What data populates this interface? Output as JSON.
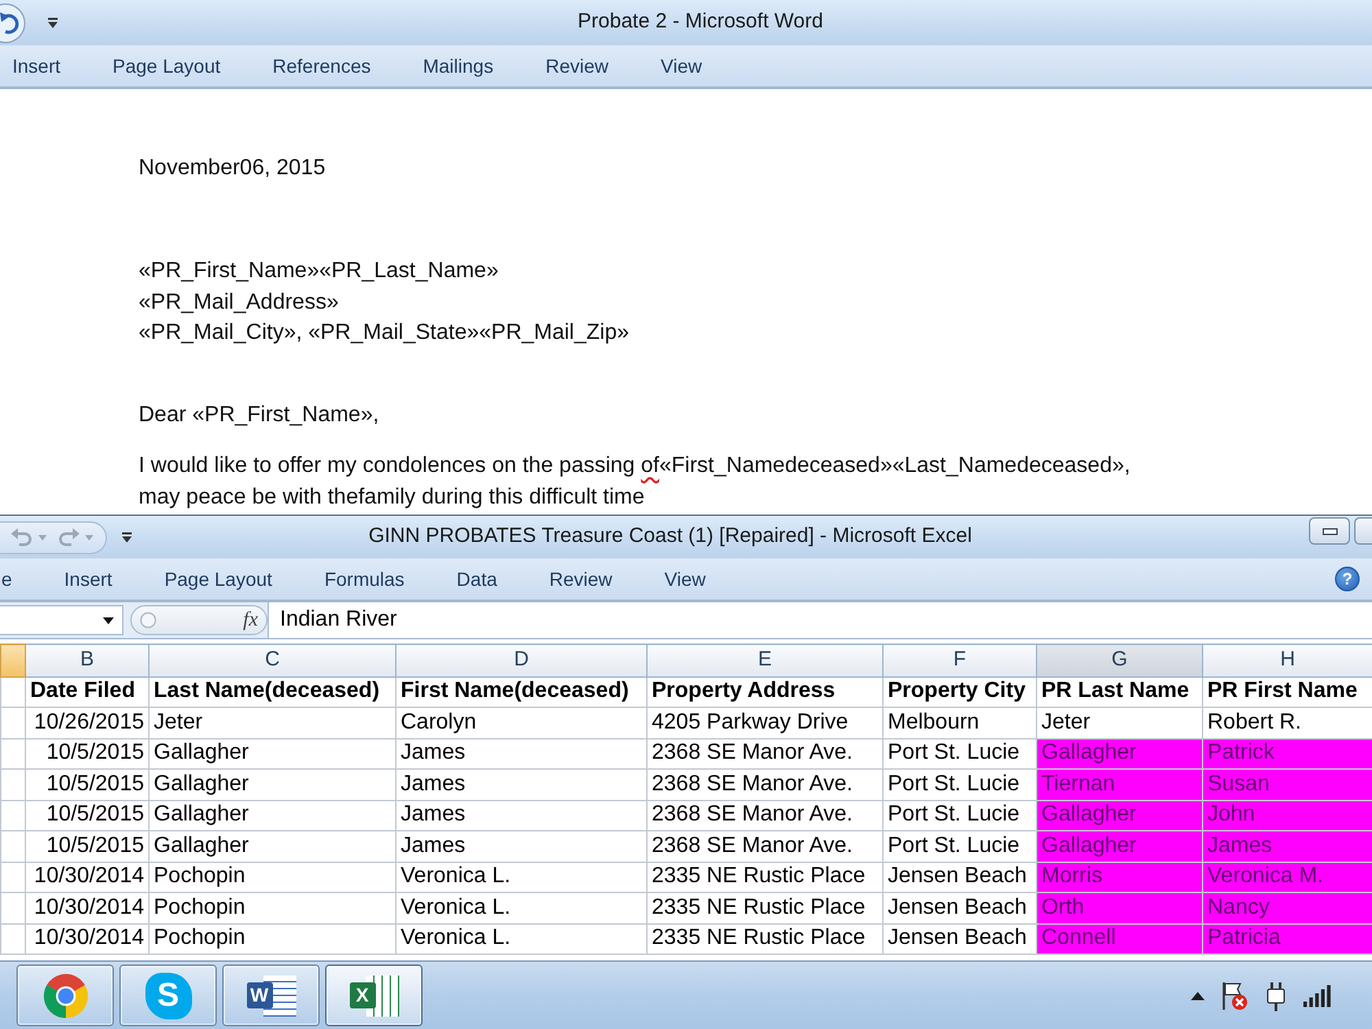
{
  "word": {
    "title": "Probate 2 - Microsoft Word",
    "tabs": [
      {
        "label": "Insert",
        "selected": false
      },
      {
        "label": "Page Layout",
        "selected": false
      },
      {
        "label": "References",
        "selected": false
      },
      {
        "label": "Mailings",
        "selected": false
      },
      {
        "label": "Review",
        "selected": false
      },
      {
        "label": "View",
        "selected": false
      }
    ],
    "document": {
      "date": "November06, 2015",
      "address_lines": [
        "«PR_First_Name»«PR_Last_Name»",
        "«PR_Mail_Address»",
        "«PR_Mail_City», «PR_Mail_State»«PR_Mail_Zip»"
      ],
      "salutation": "Dear «PR_First_Name»,",
      "paragraph_lines": [
        {
          "runs": [
            {
              "text": "I would like to offer my condolences on the passing ",
              "misspelled": false
            },
            {
              "text": "of",
              "misspelled": true
            },
            {
              "text": "«First_Namedeceased»«Last_Namedeceased»,",
              "misspelled": false
            }
          ]
        },
        {
          "runs": [
            {
              "text": "may peace be with thefamily during this difficult time",
              "misspelled": false
            }
          ]
        }
      ]
    }
  },
  "excel": {
    "title": "GINN PROBATES Treasure Coast (1) [Repaired] - Microsoft Excel",
    "tabs": [
      {
        "label": "e",
        "selected": false
      },
      {
        "label": "Insert",
        "selected": false
      },
      {
        "label": "Page Layout",
        "selected": false
      },
      {
        "label": "Formulas",
        "selected": false
      },
      {
        "label": "Data",
        "selected": false
      },
      {
        "label": "Review",
        "selected": false
      },
      {
        "label": "View",
        "selected": false
      }
    ],
    "help": "?",
    "formula_bar": {
      "function_button": "fx",
      "value": "Indian River"
    },
    "columns": [
      {
        "selected": true,
        "hovered": false
      },
      {
        "letter": "B",
        "selected": false,
        "hovered": false
      },
      {
        "letter": "C",
        "selected": false,
        "hovered": false
      },
      {
        "letter": "D",
        "selected": false,
        "hovered": false
      },
      {
        "letter": "E",
        "selected": false,
        "hovered": false
      },
      {
        "letter": "F",
        "selected": false,
        "hovered": false
      },
      {
        "letter": "G",
        "selected": false,
        "hovered": true
      },
      {
        "letter": "H",
        "selected": false,
        "hovered": false
      }
    ],
    "rows": [
      {
        "kind": "header",
        "cells": [
          "",
          "Date Filed",
          "Last Name(deceased)",
          "First Name(deceased)",
          "Property Address",
          "Property City",
          "PR Last Name",
          "PR First Name"
        ],
        "highlighted": false
      },
      {
        "kind": "data",
        "cells": [
          "",
          "10/26/2015",
          "Jeter",
          "Carolyn",
          "4205 Parkway Drive",
          "Melbourn",
          "Jeter",
          "Robert R."
        ],
        "highlighted": false
      },
      {
        "kind": "data",
        "cells": [
          "",
          "10/5/2015",
          "Gallagher",
          "James",
          "2368 SE Manor Ave.",
          "Port St. Lucie",
          "Gallagher",
          "Patrick"
        ],
        "highlighted": true
      },
      {
        "kind": "data",
        "cells": [
          "",
          "10/5/2015",
          "Gallagher",
          "James",
          "2368 SE Manor Ave.",
          "Port St. Lucie",
          "Tiernan",
          "Susan"
        ],
        "highlighted": true
      },
      {
        "kind": "data",
        "cells": [
          "",
          "10/5/2015",
          "Gallagher",
          "James",
          "2368 SE Manor Ave.",
          "Port St. Lucie",
          "Gallagher",
          "John"
        ],
        "highlighted": true
      },
      {
        "kind": "data",
        "cells": [
          "",
          "10/5/2015",
          "Gallagher",
          "James",
          "2368 SE Manor Ave.",
          "Port St. Lucie",
          "Gallagher",
          "James"
        ],
        "highlighted": true
      },
      {
        "kind": "data",
        "cells": [
          "",
          "10/30/2014",
          "Pochopin",
          "Veronica L.",
          "2335 NE Rustic Place",
          "Jensen Beach",
          "Morris",
          "Veronica M."
        ],
        "highlighted": true
      },
      {
        "kind": "data",
        "cells": [
          "",
          "10/30/2014",
          "Pochopin",
          "Veronica L.",
          "2335 NE Rustic Place",
          "Jensen Beach",
          "Orth",
          "Nancy"
        ],
        "highlighted": true
      },
      {
        "kind": "data",
        "cells": [
          "",
          "10/30/2014",
          "Pochopin",
          "Veronica L.",
          "2335 NE Rustic Place",
          "Jensen Beach",
          "Connell",
          "Patricia"
        ],
        "highlighted": true
      }
    ]
  },
  "taskbar": {
    "apps": [
      {
        "kind": "browser",
        "selected": false
      },
      {
        "kind": "chat",
        "glyph": "S",
        "selected": false
      },
      {
        "kind": "document",
        "glyph": "W",
        "selected": false
      },
      {
        "kind": "spreadsheet",
        "glyph": "X",
        "selected": true
      }
    ]
  }
}
